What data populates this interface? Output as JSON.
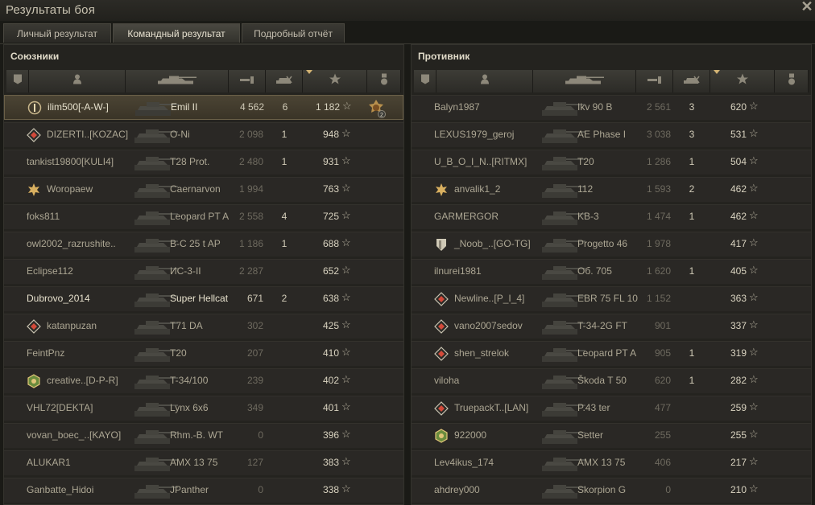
{
  "window": {
    "title": "Результаты боя",
    "close": "✕"
  },
  "tabs": [
    "Личный результат",
    "Командный результат",
    "Подробный отчёт"
  ],
  "active_tab": 1,
  "allies": {
    "title": "Союзники",
    "rows": [
      {
        "name": "ilim500[-A-W-]",
        "badge": "rank1-icon",
        "tank": "Emil II",
        "dmg": "4 562",
        "kills": "6",
        "xp": "1 182",
        "medal": "medal-2-icon",
        "me": true
      },
      {
        "name": "DIZERTI..[KOZAC]",
        "badge": "diamond-icon",
        "tank": "O-Ni",
        "dmg": "2 098",
        "kills": "1",
        "xp": "948"
      },
      {
        "name": "tankist19800[KULI4]",
        "tank": "T28 Prot.",
        "dmg": "2 480",
        "kills": "1",
        "xp": "931"
      },
      {
        "name": "Woropaew",
        "badge": "gold-star-icon",
        "tank": "Caernarvon",
        "dmg": "1 994",
        "kills": "",
        "xp": "763"
      },
      {
        "name": "foks811",
        "tank": "Leopard PT A",
        "dmg": "2 558",
        "kills": "4",
        "xp": "725"
      },
      {
        "name": "owl2002_razrushite..",
        "tank": "B-C 25 t AP",
        "dmg": "1 186",
        "kills": "1",
        "xp": "688"
      },
      {
        "name": "Eclipse112",
        "tank": "ИС-3-II",
        "dmg": "2 287",
        "kills": "",
        "xp": "652"
      },
      {
        "name": "Dubrovo_2014",
        "tank": "Super Hellcat",
        "dmg": "671",
        "kills": "2",
        "xp": "638",
        "bright": true
      },
      {
        "name": "katanpuzan",
        "badge": "diamond-icon",
        "tank": "T71 DA",
        "dmg": "302",
        "kills": "",
        "xp": "425"
      },
      {
        "name": "FeintPnz",
        "tank": "T20",
        "dmg": "207",
        "kills": "",
        "xp": "410"
      },
      {
        "name": "creative..[D-P-R]",
        "badge": "clan-emblem-icon",
        "tank": "T-34/100",
        "dmg": "239",
        "kills": "",
        "xp": "402"
      },
      {
        "name": "VHL72[DEKTA]",
        "tank": "Lynx 6x6",
        "dmg": "349",
        "kills": "",
        "xp": "401"
      },
      {
        "name": "vovan_boec_..[KAYO]",
        "tank": "Rhm.-B. WT",
        "dmg": "0",
        "kills": "",
        "xp": "396"
      },
      {
        "name": "ALUKAR1",
        "tank": "AMX 13 75",
        "dmg": "127",
        "kills": "",
        "xp": "383"
      },
      {
        "name": "Ganbatte_Hidoi",
        "tank": "JPanther",
        "dmg": "0",
        "kills": "",
        "xp": "338"
      }
    ]
  },
  "enemies": {
    "title": "Противник",
    "rows": [
      {
        "name": "Balyn1987",
        "tank": "Ikv 90 B",
        "dmg": "2 561",
        "kills": "3",
        "xp": "620"
      },
      {
        "name": "LEXUS1979_geroj",
        "tank": "AE Phase I",
        "dmg": "3 038",
        "kills": "3",
        "xp": "531"
      },
      {
        "name": "U_B_O_I_N..[RITMX]",
        "tank": "T20",
        "dmg": "1 286",
        "kills": "1",
        "xp": "504"
      },
      {
        "name": "anvalik1_2",
        "badge": "gold-star-icon",
        "tank": "112",
        "dmg": "1 593",
        "kills": "2",
        "xp": "462"
      },
      {
        "name": "GARMERGOR",
        "tank": "KB-3",
        "dmg": "1 474",
        "kills": "1",
        "xp": "462"
      },
      {
        "name": "_Noob_..[GO-TG]",
        "badge": "shield-icon",
        "tank": "Progetto 46",
        "dmg": "1 978",
        "kills": "",
        "xp": "417"
      },
      {
        "name": "ilnurei1981",
        "tank": "Об. 705",
        "dmg": "1 620",
        "kills": "1",
        "xp": "405"
      },
      {
        "name": "Newline..[P_I_4]",
        "badge": "diamond-icon",
        "tank": "EBR 75 FL 10",
        "dmg": "1 152",
        "kills": "",
        "xp": "363"
      },
      {
        "name": "vano2007sedov",
        "badge": "diamond-icon",
        "tank": "T-34-2G FT",
        "dmg": "901",
        "kills": "",
        "xp": "337"
      },
      {
        "name": "shen_strelok",
        "badge": "diamond-icon",
        "tank": "Leopard PT A",
        "dmg": "905",
        "kills": "1",
        "xp": "319"
      },
      {
        "name": "viloha",
        "tank": "Škoda T 50",
        "dmg": "620",
        "kills": "1",
        "xp": "282"
      },
      {
        "name": "TruepackT..[LAN]",
        "badge": "diamond-icon",
        "tank": "P.43 ter",
        "dmg": "477",
        "kills": "",
        "xp": "259"
      },
      {
        "name": "922000",
        "badge": "clan-emblem-icon",
        "tank": "Setter",
        "dmg": "255",
        "kills": "",
        "xp": "255"
      },
      {
        "name": "Lev4ikus_174",
        "tank": "AMX 13 75",
        "dmg": "406",
        "kills": "",
        "xp": "217"
      },
      {
        "name": "ahdrey000",
        "tank": "Skorpion G",
        "dmg": "0",
        "kills": "",
        "xp": "210"
      }
    ]
  },
  "star_glyph": "☆",
  "colors": {
    "accent": "#d2b373",
    "text": "#aca693",
    "me_row": "#4b4434"
  }
}
